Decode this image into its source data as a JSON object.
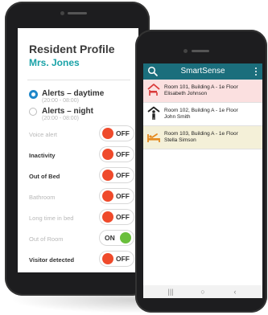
{
  "resident_profile": {
    "title": "Resident Profile",
    "resident_name": "Mrs. Jones",
    "alert_modes": [
      {
        "label": "Alerts – daytime",
        "time": "(20:00 - 08:00)",
        "selected": true
      },
      {
        "label": "Alerts – night",
        "time": "(20:00 - 08:00)",
        "selected": false
      }
    ],
    "settings": [
      {
        "label": "Voice alert",
        "state": "OFF",
        "enabled": false
      },
      {
        "label": "Inactivity",
        "state": "OFF",
        "enabled": true
      },
      {
        "label": "Out of Bed",
        "state": "OFF",
        "enabled": true
      },
      {
        "label": "Bathroom",
        "state": "OFF",
        "enabled": false
      },
      {
        "label": "Long time in bed",
        "state": "OFF",
        "enabled": false
      },
      {
        "label": "Out of Room",
        "state": "ON",
        "enabled": false
      },
      {
        "label": "Visitor detected",
        "state": "OFF",
        "enabled": true
      }
    ]
  },
  "smartsense": {
    "app_title": "SmartSense",
    "search_icon": "search-icon",
    "menu_icon": "more-vert-icon",
    "rooms": [
      {
        "line1": "Room 101, Building A - 1e Floor",
        "line2": "Elisabeth Johnson",
        "icon": "bed-exit-icon",
        "bg": "#fbe0e0",
        "icon_color": "#d93a3a"
      },
      {
        "line1": "Room 102, Building A - 1e Floor",
        "line2": "John Smith",
        "icon": "person-standing-icon",
        "bg": "#ffffff",
        "icon_color": "#222222"
      },
      {
        "line1": "Room 103, Building A - 1e Floor",
        "line2": "Stella Simson",
        "icon": "out-of-bed-icon",
        "bg": "#f4f0d8",
        "icon_color": "#e58a1f"
      }
    ],
    "nav": {
      "recents": "|||",
      "home": "○",
      "back": "‹"
    }
  },
  "colors": {
    "teal_header": "#1b6e7c",
    "teal_name": "#1ba3a8",
    "toggle_off": "#ef4a2b",
    "toggle_on": "#6abf3c",
    "radio_selected": "#1f87c9"
  }
}
